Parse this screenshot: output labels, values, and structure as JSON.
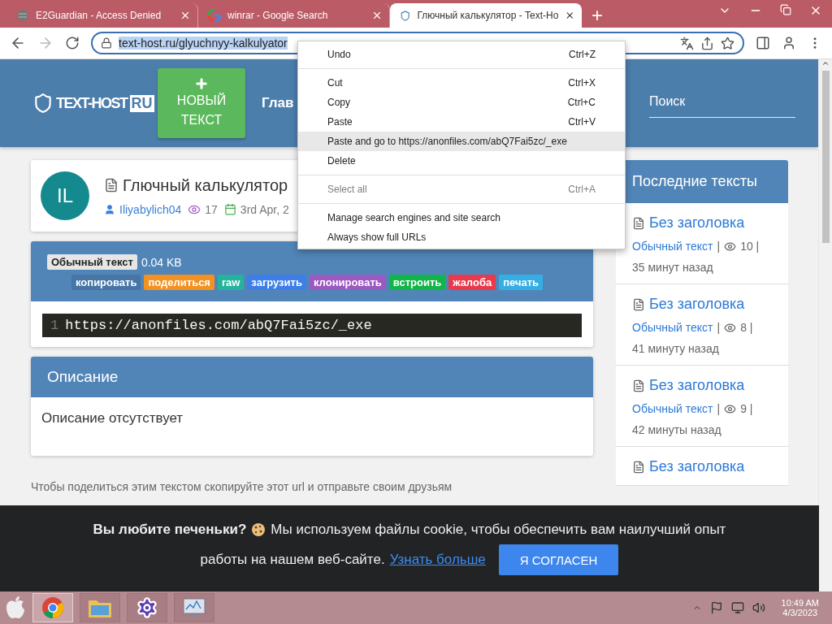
{
  "browser": {
    "tabs": [
      {
        "kind": "blocked",
        "title": "E2Guardian - Access Denied",
        "selected": false
      },
      {
        "kind": "google",
        "title": "winrar - Google Search",
        "selected": false
      },
      {
        "kind": "site",
        "title": "Глючный калькулятор - Text-Ho",
        "selected": true
      }
    ],
    "new_tab": "+",
    "address": {
      "url": "text-host.ru/glyuchnyy-kalkulyator",
      "selected": true
    }
  },
  "site_header": {
    "logo": {
      "text": "TEXT-HOST",
      "badge": "RU"
    },
    "new_text_button": "НОВЫЙ ТЕКСТ",
    "nav": [
      "Глав"
    ],
    "search": {
      "placeholder": "Поиск"
    }
  },
  "paste": {
    "avatar": "IL",
    "title": "Глючный калькулятор",
    "author": "Iliyabylich04",
    "views": "17",
    "date": "3rd Apr, 2",
    "syntax": "Обычный текст",
    "size": "0.04 KB",
    "actions": [
      {
        "label": "копировать",
        "color": "#4675a6"
      },
      {
        "label": "поделиться",
        "color": "#f39121"
      },
      {
        "label": "raw",
        "color": "#24b39e"
      },
      {
        "label": "загрузить",
        "color": "#3d7ee8"
      },
      {
        "label": "клонировать",
        "color": "#9b59c2"
      },
      {
        "label": "встроить",
        "color": "#12b54a"
      },
      {
        "label": "жалоба",
        "color": "#e93a4c"
      },
      {
        "label": "печать",
        "color": "#35aee4"
      }
    ],
    "code": [
      {
        "number": "1",
        "text": "https://anonfiles.com/abQ7Fai5zc/_exe"
      }
    ]
  },
  "description": {
    "title": "Описание",
    "text": "Описание отсутствует"
  },
  "share_hint": "Чтобы поделиться этим текстом скопируйте этот url и отправьте своим друзьям",
  "sidebar": {
    "title": "Последние тексты",
    "items": [
      {
        "title": "Без заголовка",
        "syntax": "Обычный текст",
        "pipe": "|",
        "views": "10 |",
        "time": "35 минут назад"
      },
      {
        "title": "Без заголовка",
        "syntax": "Обычный текст",
        "pipe": "|",
        "views": "8 |",
        "time": "41 минуту назад"
      },
      {
        "title": "Без заголовка",
        "syntax": "Обычный текст",
        "pipe": "|",
        "views": "9 |",
        "time": "42 минуты назад"
      },
      {
        "title": "Без заголовка"
      }
    ]
  },
  "context_menu": {
    "items": [
      {
        "kind": "item",
        "label": "Undo",
        "shortcut": "Ctrl+Z",
        "disabled": false,
        "selected": false
      },
      {
        "kind": "separator"
      },
      {
        "kind": "item",
        "label": "Cut",
        "shortcut": "Ctrl+X",
        "disabled": false,
        "selected": false
      },
      {
        "kind": "item",
        "label": "Copy",
        "shortcut": "Ctrl+C",
        "disabled": false,
        "selected": false
      },
      {
        "kind": "item",
        "label": "Paste",
        "shortcut": "Ctrl+V",
        "disabled": false,
        "selected": false
      },
      {
        "kind": "item",
        "label": "Paste and go to https://anonfiles.com/abQ7Fai5zc/_exe",
        "disabled": false,
        "selected": true
      },
      {
        "kind": "item",
        "label": "Delete",
        "disabled": false,
        "selected": false
      },
      {
        "kind": "separator"
      },
      {
        "kind": "item",
        "label": "Select all",
        "shortcut": "Ctrl+A",
        "disabled": true,
        "selected": false
      },
      {
        "kind": "separator"
      },
      {
        "kind": "item",
        "label": "Manage search engines and site search",
        "disabled": false,
        "selected": false
      },
      {
        "kind": "item",
        "label": "Always show full URLs",
        "disabled": false,
        "selected": false
      }
    ]
  },
  "cookie_banner": {
    "question": "Вы любите печеньки?",
    "message": [
      "Мы используем файлы cookie, чтобы обеспечить вам наилучший опыт",
      "работы на нашем веб-сайте."
    ],
    "link": "Узнать больше",
    "button": "Я СОГЛАСЕН"
  },
  "taskbar": {
    "apps": [
      {
        "kind": "browser",
        "selected": true
      },
      {
        "kind": "folder",
        "selected": false
      },
      {
        "kind": "settings",
        "selected": false
      },
      {
        "kind": "monitor",
        "selected": false
      }
    ],
    "clock": {
      "time": "10:49 AM",
      "date": "4/3/2023"
    }
  }
}
